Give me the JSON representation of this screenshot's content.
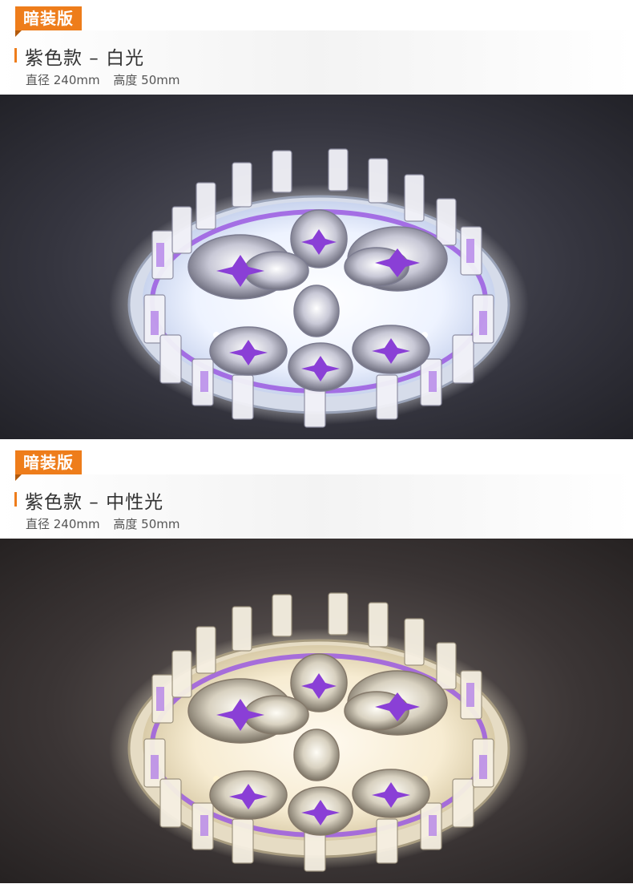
{
  "sections": [
    {
      "tag": "暗装版",
      "title": "紫色款 – 白光",
      "spec_diameter": "直径 240mm",
      "spec_height": "高度 50mm",
      "image_icon": "crystal-ceiling-light-white",
      "glow_color": "#ffffff",
      "bg_color": "#2a2a32"
    },
    {
      "tag": "暗装版",
      "title": "紫色款 – 中性光",
      "spec_diameter": "直径 240mm",
      "spec_height": "高度 50mm",
      "image_icon": "crystal-ceiling-light-neutral",
      "glow_color": "#fff6dc",
      "bg_color": "#2e2a2a"
    }
  ],
  "colors": {
    "accent": "#ee7d1b",
    "purple": "#8a3fd6"
  }
}
